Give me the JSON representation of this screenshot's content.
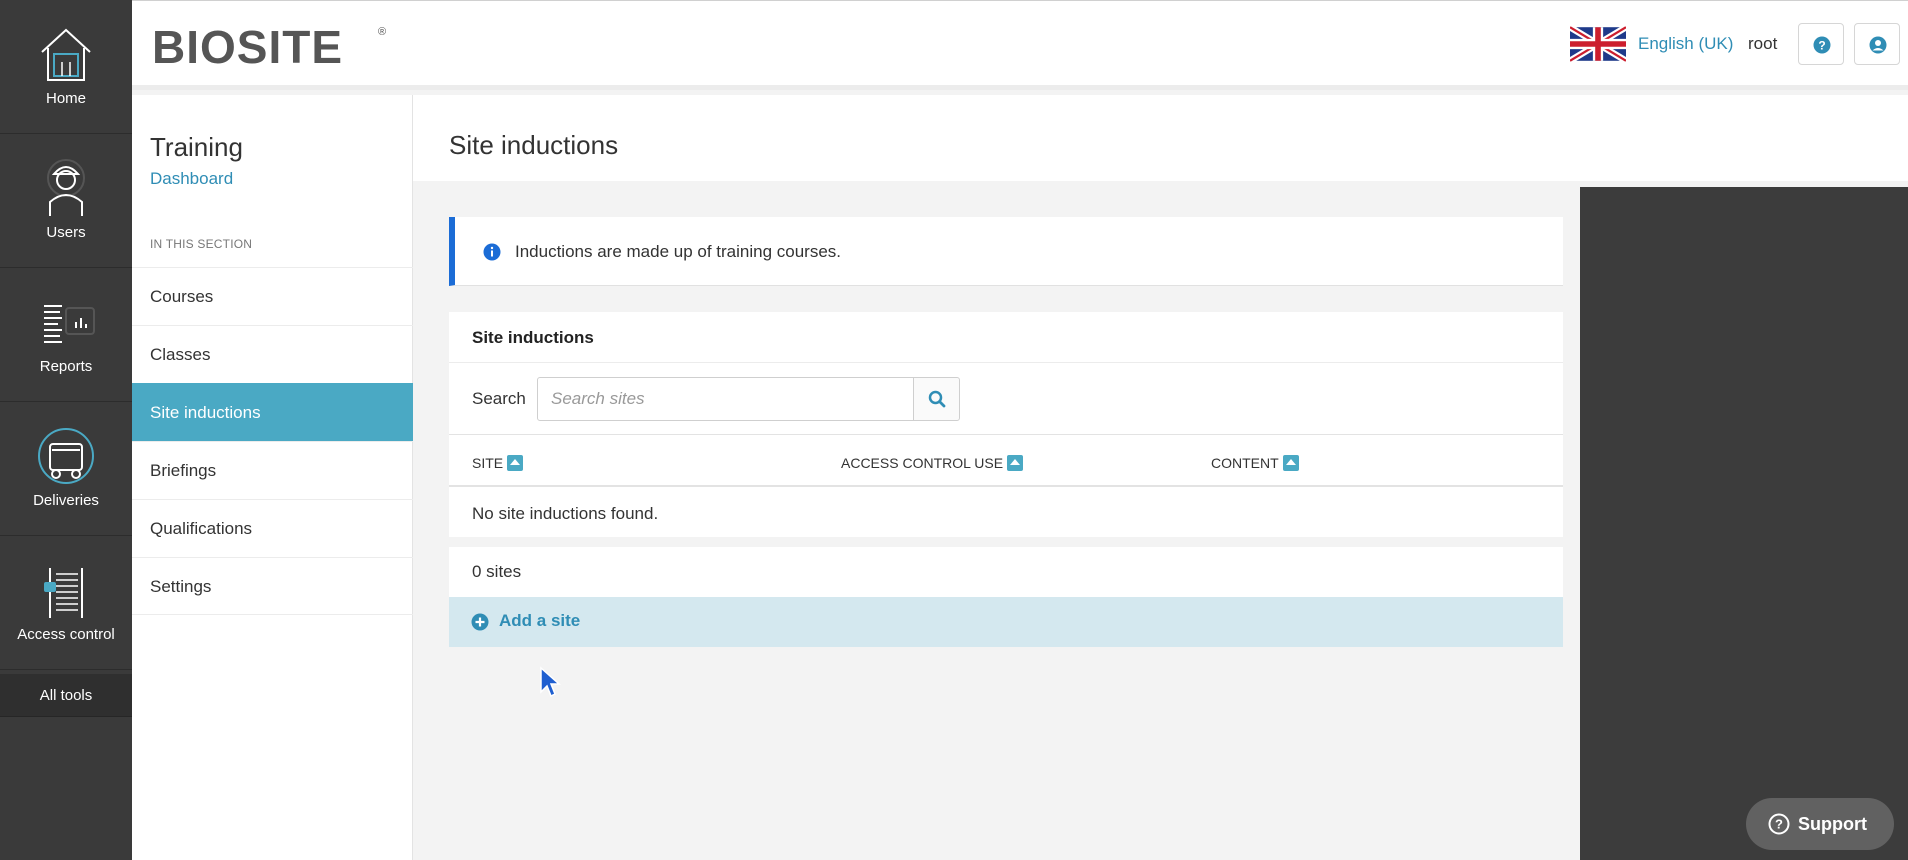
{
  "rail": {
    "items": [
      {
        "label": "Home",
        "icon": "home-icon"
      },
      {
        "label": "Users",
        "icon": "worker-icon"
      },
      {
        "label": "Reports",
        "icon": "reports-icon"
      },
      {
        "label": "Deliveries",
        "icon": "truck-icon"
      },
      {
        "label": "Access control",
        "icon": "turnstile-icon"
      }
    ],
    "all_tools": "All tools"
  },
  "header": {
    "logo": "BIOSITE",
    "language": "English (UK)",
    "user": "root",
    "help_icon": "question-icon",
    "profile_icon": "user-circle-icon"
  },
  "sidebar": {
    "title": "Training",
    "dashboard_link": "Dashboard",
    "section_label": "IN THIS SECTION",
    "items": [
      {
        "label": "Courses"
      },
      {
        "label": "Classes"
      },
      {
        "label": "Site inductions",
        "active": true
      },
      {
        "label": "Briefings"
      },
      {
        "label": "Qualifications"
      },
      {
        "label": "Settings"
      }
    ]
  },
  "main": {
    "page_title": "Site inductions",
    "info_text": "Inductions are made up of training courses.",
    "panel_title": "Site inductions",
    "search_label": "Search",
    "search_placeholder": "Search sites",
    "search_value": "",
    "columns": [
      "SITE",
      "ACCESS CONTROL USE",
      "CONTENT"
    ],
    "empty_message": "No site inductions found.",
    "count": "0 sites",
    "add_label": "Add a site"
  },
  "support": {
    "label": "Support"
  },
  "colors": {
    "rail_bg": "#3a3a3a",
    "accent": "#4aa9c4",
    "link": "#2f8db5",
    "info_border": "#1b6cd6"
  }
}
